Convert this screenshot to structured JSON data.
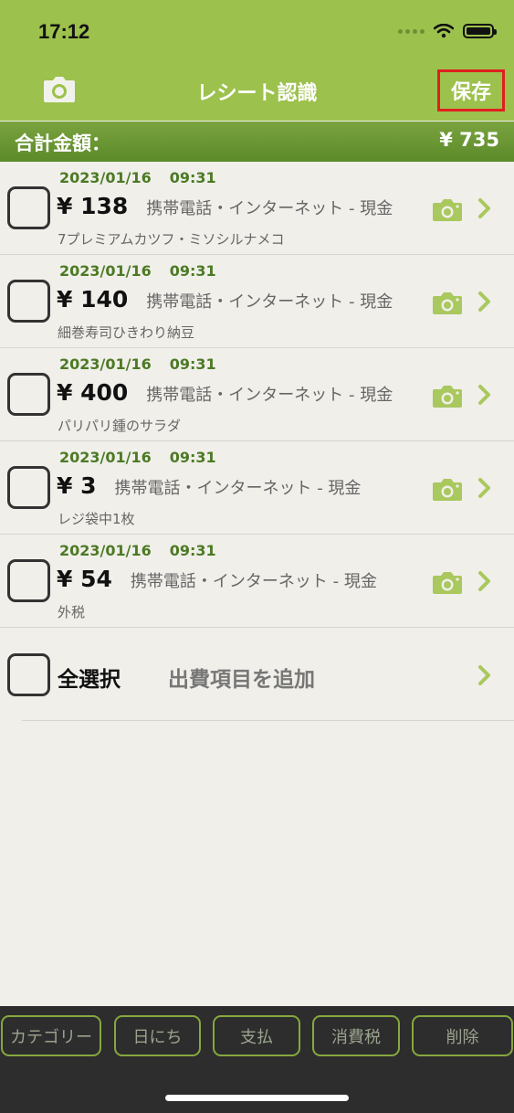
{
  "status": {
    "time": "17:12"
  },
  "nav": {
    "title": "レシート認識",
    "save_label": "保存"
  },
  "total": {
    "label": "合計金額：",
    "value": "¥ 735"
  },
  "items": [
    {
      "date": "2023/01/16",
      "time": "09:31",
      "amount": "¥ 138",
      "category": "携帯電話・インターネット - 現金",
      "note": "7プレミアムカツフ・ミソシルナメコ"
    },
    {
      "date": "2023/01/16",
      "time": "09:31",
      "amount": "¥ 140",
      "category": "携帯電話・インターネット - 現金",
      "note": "細巻寿司ひきわり納豆"
    },
    {
      "date": "2023/01/16",
      "time": "09:31",
      "amount": "¥ 400",
      "category": "携帯電話・インターネット - 現金",
      "note": "パリパリ鍾のサラダ"
    },
    {
      "date": "2023/01/16",
      "time": "09:31",
      "amount": "¥ 3",
      "category": "携帯電話・インターネット - 現金",
      "note": "レジ袋中1枚"
    },
    {
      "date": "2023/01/16",
      "time": "09:31",
      "amount": "¥ 54",
      "category": "携帯電話・インターネット - 現金",
      "note": "外税"
    }
  ],
  "select_all": {
    "label": "全選択",
    "add_label": "出費項目を追加"
  },
  "toolbar": {
    "category": "カテゴリー",
    "date": "日にち",
    "payment": "支払",
    "tax": "消費税",
    "delete": "削除"
  },
  "colors": {
    "accent": "#9cc14d",
    "total_bar": "#6b9535",
    "date_text": "#4c7a24",
    "icon_green": "#a9c85d",
    "save_border": "#e0201f"
  },
  "icons": {
    "nav_camera": "camera-icon",
    "row_camera": "camera-icon",
    "row_link": "chevron-right-icon",
    "wifi": "wifi-icon",
    "battery": "battery-icon"
  }
}
